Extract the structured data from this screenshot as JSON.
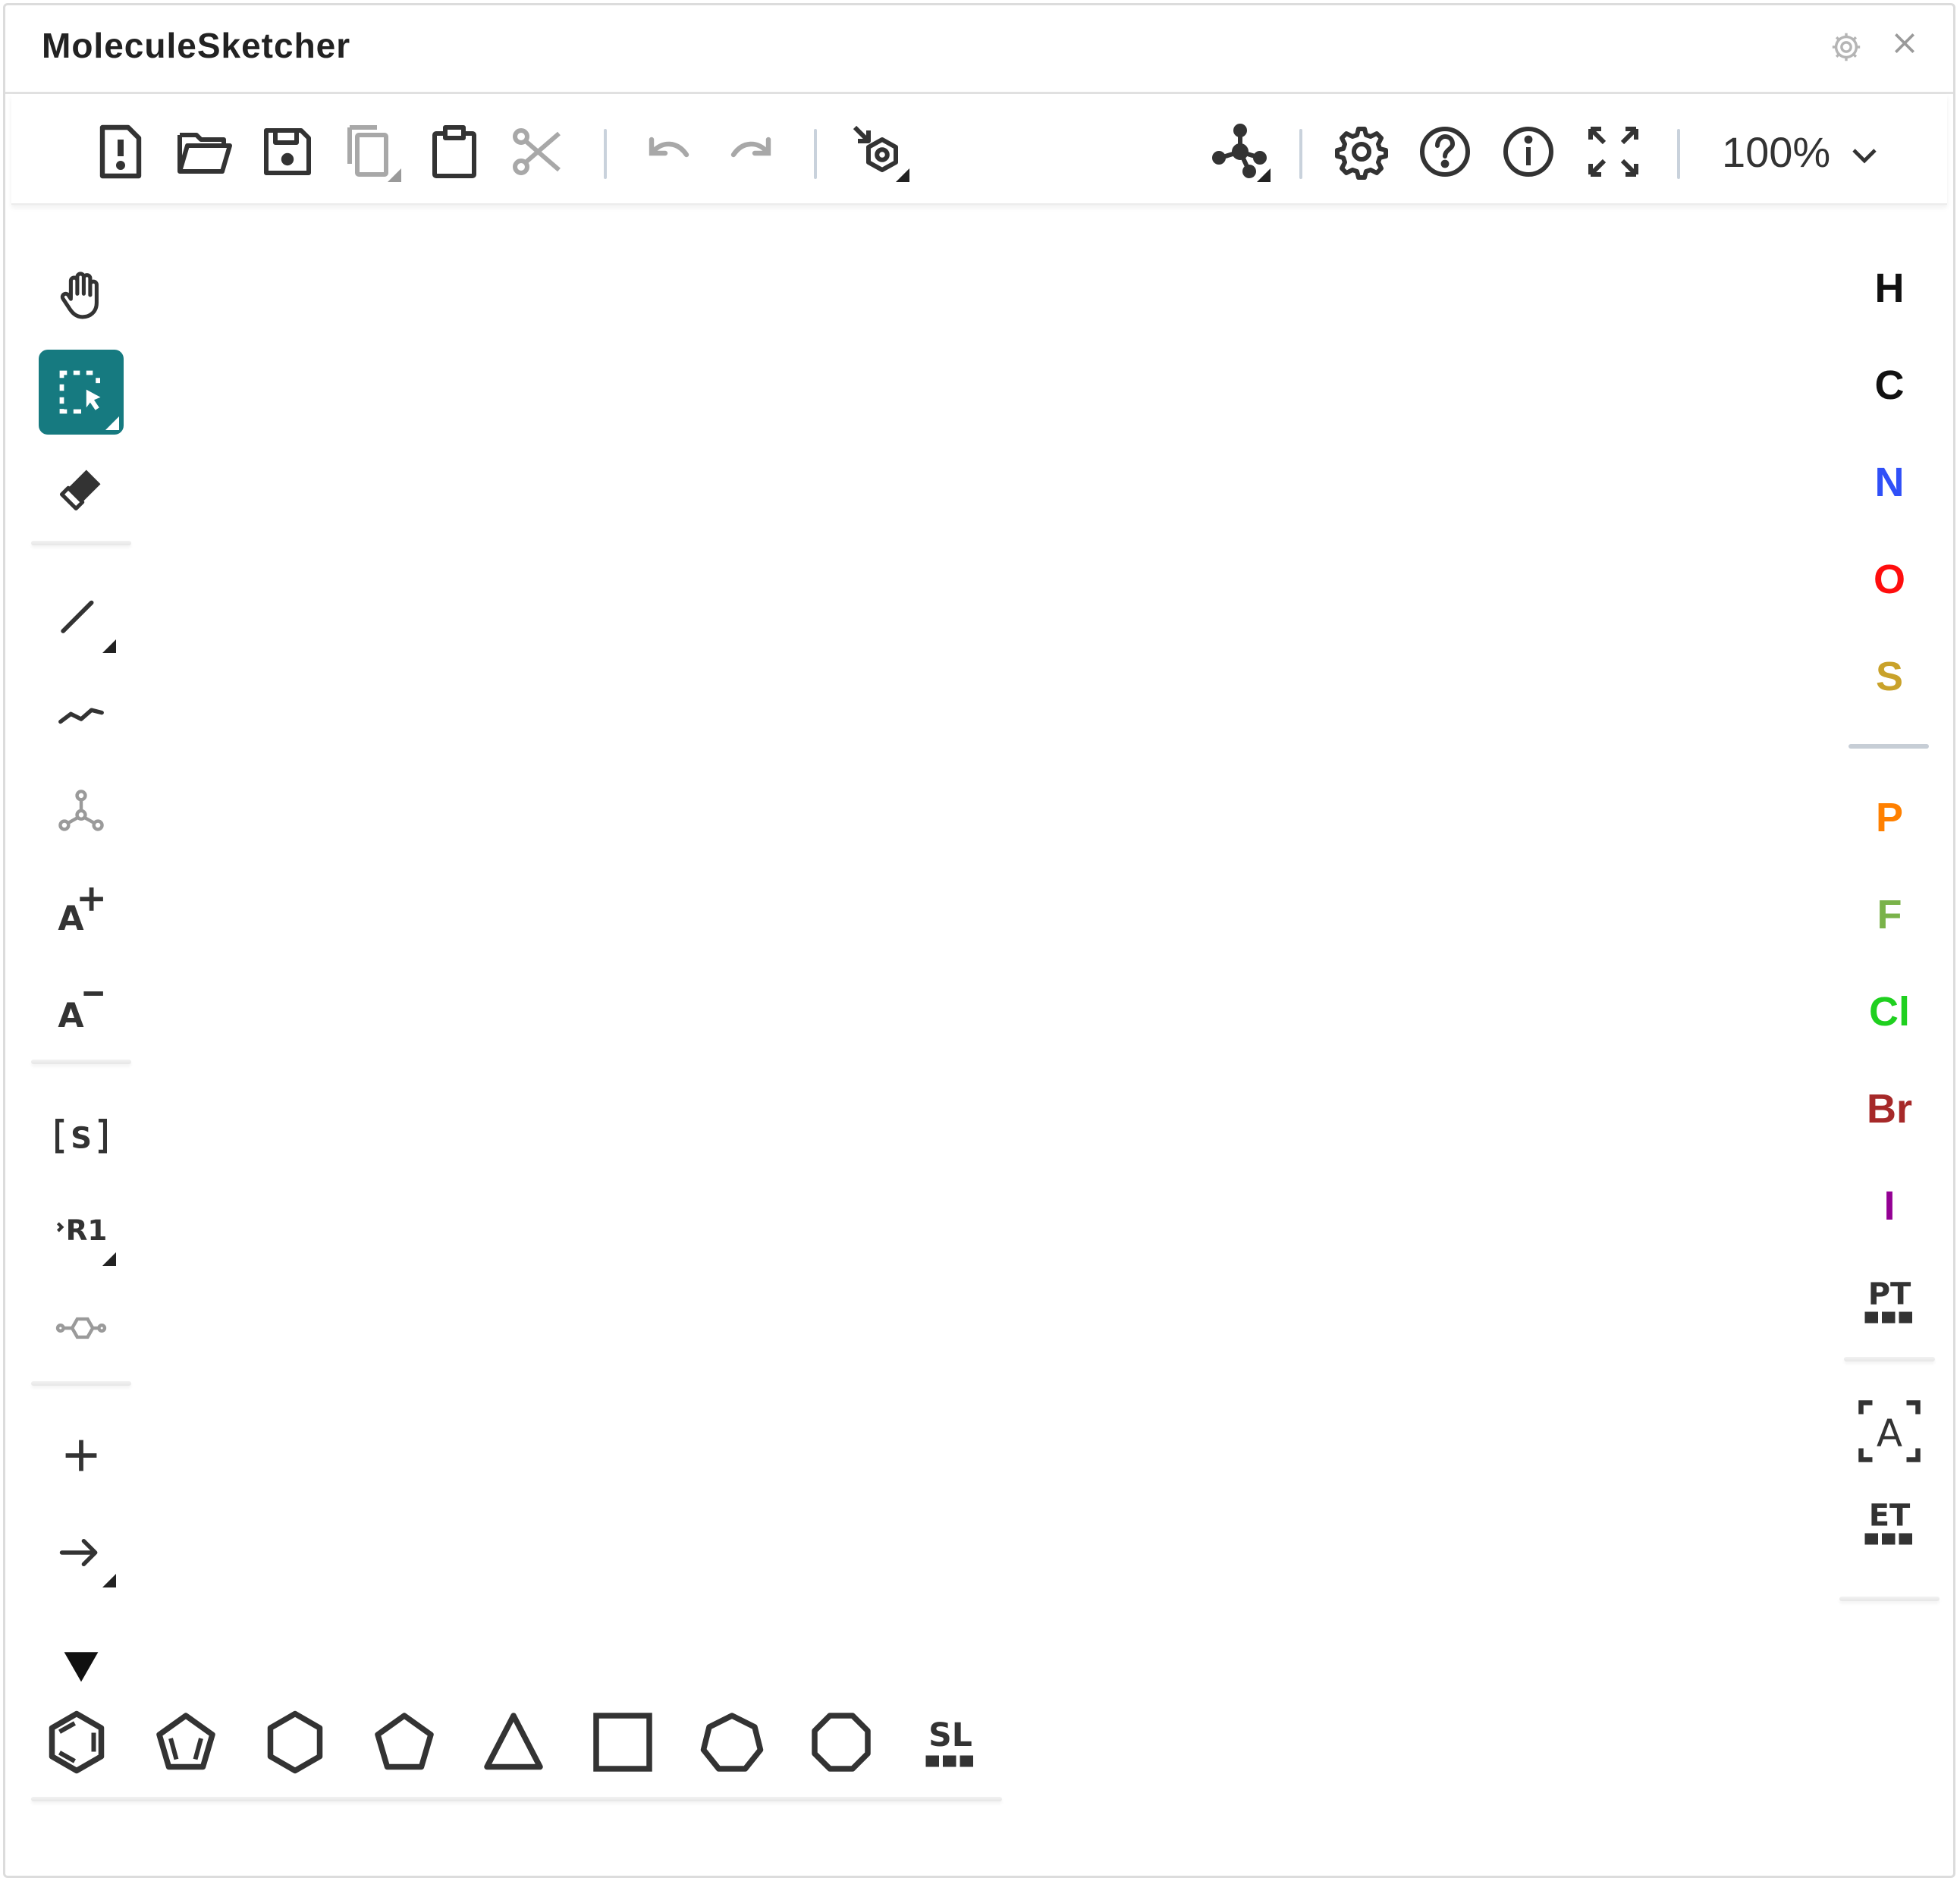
{
  "app": {
    "title": "MoleculeSketcher"
  },
  "titlebar": {
    "settings_icon": "gear-icon",
    "close_icon": "close-icon"
  },
  "toolbar": {
    "left_icons": [
      "new-file-icon",
      "open-folder-icon",
      "save-icon",
      "copy-icon",
      "paste-icon",
      "cut-icon",
      "undo-icon",
      "redo-icon",
      "aromatize-icon"
    ],
    "right_icons": [
      "structure-check-icon",
      "settings-icon",
      "help-icon",
      "info-icon",
      "fullscreen-icon"
    ],
    "zoom": "100%"
  },
  "left_toolbar": {
    "tools": [
      "hand",
      "select",
      "erase",
      "single-bond",
      "chain",
      "template-atom",
      "charge-plus",
      "charge-minus",
      "sgroup",
      "rgroup",
      "attachment",
      "plus",
      "arrow"
    ],
    "sgroup_label": "[s]",
    "rgroup_label": "R1",
    "charge_plus_label": "A",
    "charge_minus_label": "A"
  },
  "elements": {
    "primary": [
      {
        "symbol": "H",
        "color": "#111111"
      },
      {
        "symbol": "C",
        "color": "#111111"
      },
      {
        "symbol": "N",
        "color": "#3050f8"
      },
      {
        "symbol": "O",
        "color": "#ff0d0d"
      },
      {
        "symbol": "S",
        "color": "#c9a22a"
      }
    ],
    "secondary": [
      {
        "symbol": "P",
        "color": "#ff8000"
      },
      {
        "symbol": "F",
        "color": "#7ab34a"
      },
      {
        "symbol": "Cl",
        "color": "#1fd01f"
      },
      {
        "symbol": "Br",
        "color": "#a62929"
      },
      {
        "symbol": "I",
        "color": "#940094"
      }
    ],
    "periodic_table_label": "PT",
    "extended_table_label": "ET",
    "atom_label": "A"
  },
  "bottom_toolbar": {
    "rings": [
      "benzene",
      "cyclopentadiene",
      "cyclohexane",
      "cyclopentane",
      "cyclopropane",
      "cyclobutane",
      "cycloheptane",
      "cyclooctane"
    ],
    "structure_library_label": "SL"
  }
}
